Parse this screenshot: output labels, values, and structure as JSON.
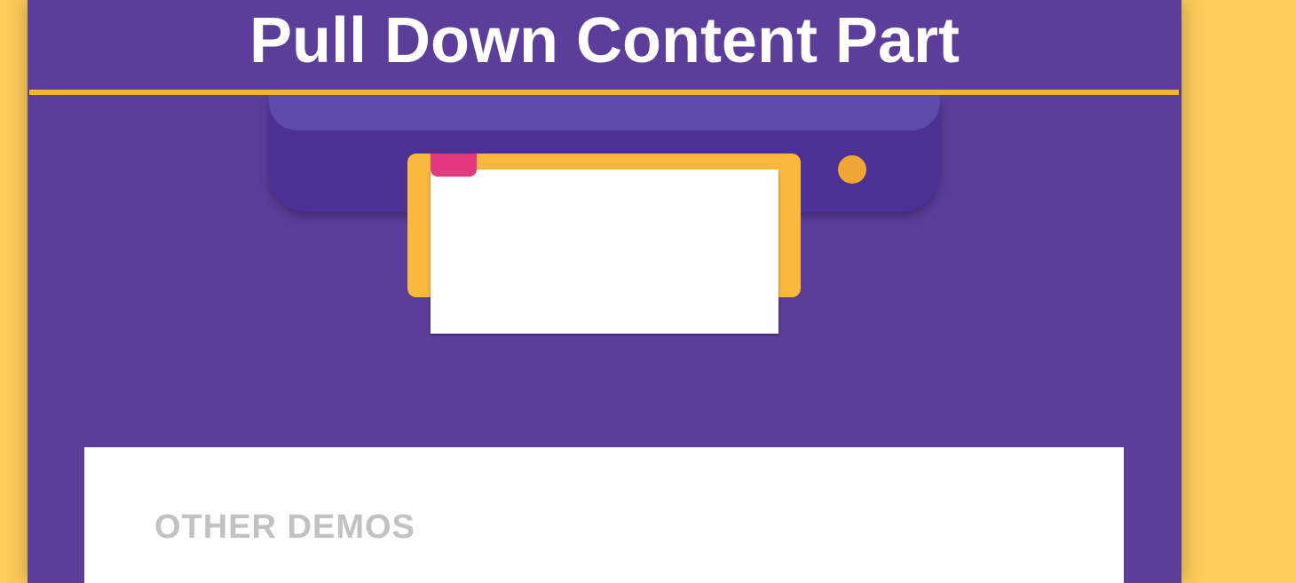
{
  "header": {
    "title": "Pull Down Content Part"
  },
  "illustration": {
    "printer_icon": "printer-icon",
    "paper_icon": "paper-icon",
    "status_light_icon": "status-light-icon"
  },
  "demos": {
    "heading": "OTHER DEMOS"
  },
  "colors": {
    "background": "#fecc5b",
    "panel": "#5b3e9a",
    "accent": "#fbb43a",
    "printer": "#4b3194",
    "printer_top": "#5e4aab",
    "paper_tab": "#e5397f",
    "heading_text": "#c2c2c2"
  }
}
